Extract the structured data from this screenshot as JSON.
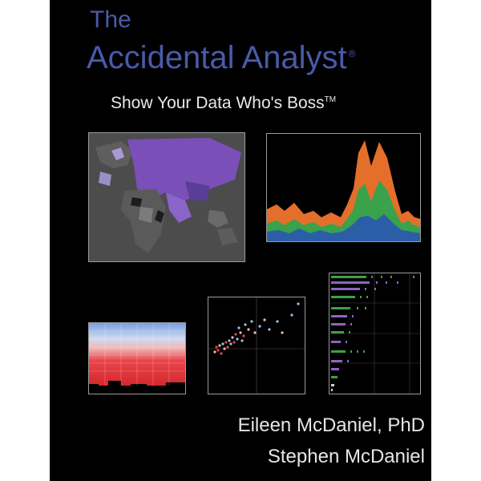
{
  "cover": {
    "title_the": "The",
    "title_main": "Accidental Analyst",
    "title_mark": "®",
    "subtitle": "Show Your Data Who's Boss",
    "subtitle_mark": "TM",
    "authors": [
      "Eileen McDaniel, PhD",
      "Stephen McDaniel"
    ]
  },
  "colors": {
    "background": "#000000",
    "title": "#4a5aa8",
    "orange": "#e46f2b",
    "green": "#3aa24a",
    "blue": "#2a5fa8",
    "purple": "#7a4fb8",
    "red": "#e8464a"
  }
}
